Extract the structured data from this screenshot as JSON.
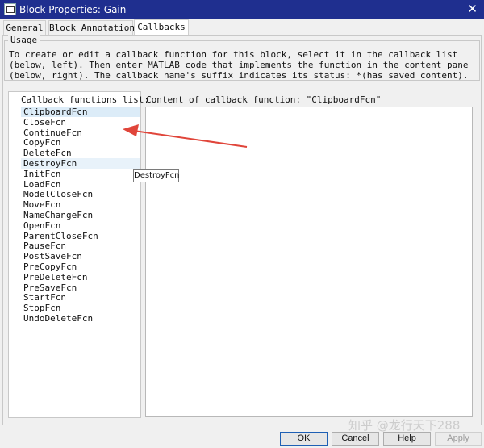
{
  "window": {
    "title": "Block Properties: Gain",
    "icon": "simulink-block-icon",
    "close": "✕"
  },
  "tabs": [
    {
      "label": "General"
    },
    {
      "label": "Block Annotation"
    },
    {
      "label": "Callbacks",
      "active": true
    }
  ],
  "usage": {
    "legend": "Usage",
    "text": "To create or edit a callback function for this block, select it in the callback list (below, left). Then enter MATLAB code that implements the function in the content pane (below, right). The callback name's suffix indicates its status: *(has saved content)."
  },
  "callbacks": {
    "legend": "Callback functions list:",
    "selected": "ClipboardFcn",
    "hovered": "DestroyFcn",
    "items": [
      "ClipboardFcn",
      "CloseFcn",
      "ContinueFcn",
      "CopyFcn",
      "DeleteFcn",
      "DestroyFcn",
      "InitFcn",
      "LoadFcn",
      "ModelCloseFcn",
      "MoveFcn",
      "NameChangeFcn",
      "OpenFcn",
      "ParentCloseFcn",
      "PauseFcn",
      "PostSaveFcn",
      "PreCopyFcn",
      "PreDeleteFcn",
      "PreSaveFcn",
      "StartFcn",
      "StopFcn",
      "UndoDeleteFcn"
    ]
  },
  "content": {
    "label": "Content of callback function: \"ClipboardFcn\"",
    "value": ""
  },
  "tooltip": "DestroyFcn",
  "buttons": {
    "ok": "OK",
    "cancel": "Cancel",
    "help": "Help",
    "apply": "Apply"
  },
  "watermark": "知乎 @龙行天下288",
  "colors": {
    "titlebar": "#1f2f8f",
    "selection": "#dcecf8",
    "annotation_arrow": "#e0453a",
    "default_button_border": "#1e5fb4"
  }
}
